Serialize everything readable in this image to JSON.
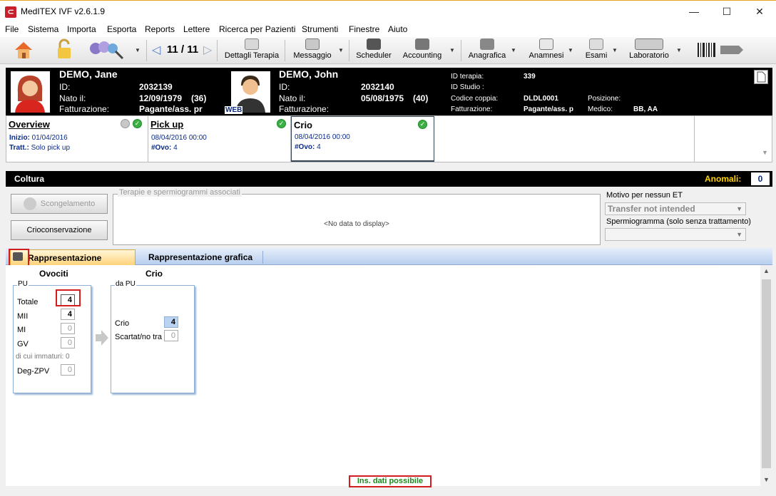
{
  "window": {
    "title": "MedITEX IVF v2.6.1.9",
    "minimize": "—",
    "maximize": "☐",
    "close": "✕"
  },
  "menu": [
    "File",
    "Sistema",
    "Importa",
    "Esporta",
    "Reports",
    "Lettere",
    "Ricerca per Pazienti",
    "Strumenti",
    "Finestre",
    "Aiuto"
  ],
  "toolbar": {
    "counter": "11 / 11",
    "items": [
      "Dettagli Terapia",
      "Messaggio",
      "Scheduler",
      "Accounting",
      "Anagrafica",
      "Anamnesi",
      "Esami",
      "Laboratorio"
    ],
    "colors": {
      "brand": "#c8202a",
      "tab_active": "#ffd37a",
      "link": "#0a2a88",
      "ok": "#1a8a1a"
    }
  },
  "patient_female": {
    "name": "DEMO, Jane",
    "id_label": "ID:",
    "id": "2032139",
    "dob_label": "Nato il:",
    "dob": "12/09/1979",
    "age": "(36)",
    "billing_label": "Fatturazione:",
    "billing": "Pagante/ass. pr"
  },
  "patient_male": {
    "name": "DEMO, John",
    "web_badge": "WEB",
    "id_label": "ID:",
    "id": "2032140",
    "dob_label": "Nato il:",
    "dob": "05/08/1975",
    "age": "(40)",
    "billing_label": "Fatturazione:"
  },
  "couple": {
    "therapy_label": "ID terapia:",
    "therapy": "339",
    "study_label": "ID Studio :",
    "code_label": "Codice coppia:",
    "code": "DLDL0001",
    "position_label": "Posizione:",
    "billing_label": "Fatturazione:",
    "billing": "Pagante/ass. p",
    "doctor_label": "Medico:",
    "doctor": "BB, AA"
  },
  "phases": {
    "overview": {
      "title": "Overview",
      "start_label": "Inizio:",
      "start": "01/04/2016",
      "treat_label": "Tratt.:",
      "treat": "Solo pick up"
    },
    "pickup": {
      "title": "Pick up",
      "datetime": "08/04/2016 00:00",
      "ovo_label": "#Ovo:",
      "ovo": "4"
    },
    "crio": {
      "title": "Crio",
      "datetime": "08/04/2016 00:00",
      "ovo_label": "#Ovo:",
      "ovo": "4"
    }
  },
  "coltura": {
    "title": "Coltura",
    "anomalies_label": "Anomali:",
    "anomalies": "0"
  },
  "actions": {
    "thaw": "Scongelamento",
    "cryo": "Crioconservazione"
  },
  "associated": {
    "label": "Terapie e spermiogrammi associati",
    "empty": "<No data to display>"
  },
  "no_et": {
    "label": "Motivo per nessun ET",
    "value": "Transfer not intended"
  },
  "sperm": {
    "label": "Spermiogramma (solo senza trattamento)",
    "value": ""
  },
  "tabs": {
    "table": "Rappresentazione tabellare",
    "graph": "Rappresentazione grafica"
  },
  "oocytes": {
    "title": "Ovociti",
    "group": "PU",
    "rows": [
      {
        "label": "Totale",
        "value": "4"
      },
      {
        "label": "MII",
        "value": "4"
      },
      {
        "label": "MI",
        "value": "0"
      },
      {
        "label": "GV",
        "value": "0"
      }
    ],
    "immature": "di cui immaturi: 0",
    "deg_label": "Deg-ZPV",
    "deg": "0"
  },
  "cryo": {
    "title": "Crio",
    "group": "da PU",
    "rows": [
      {
        "label": "Crio",
        "value": "4"
      },
      {
        "label": "Scartat/no tra",
        "value": "0"
      }
    ]
  },
  "status": "Ins. dati possibile"
}
